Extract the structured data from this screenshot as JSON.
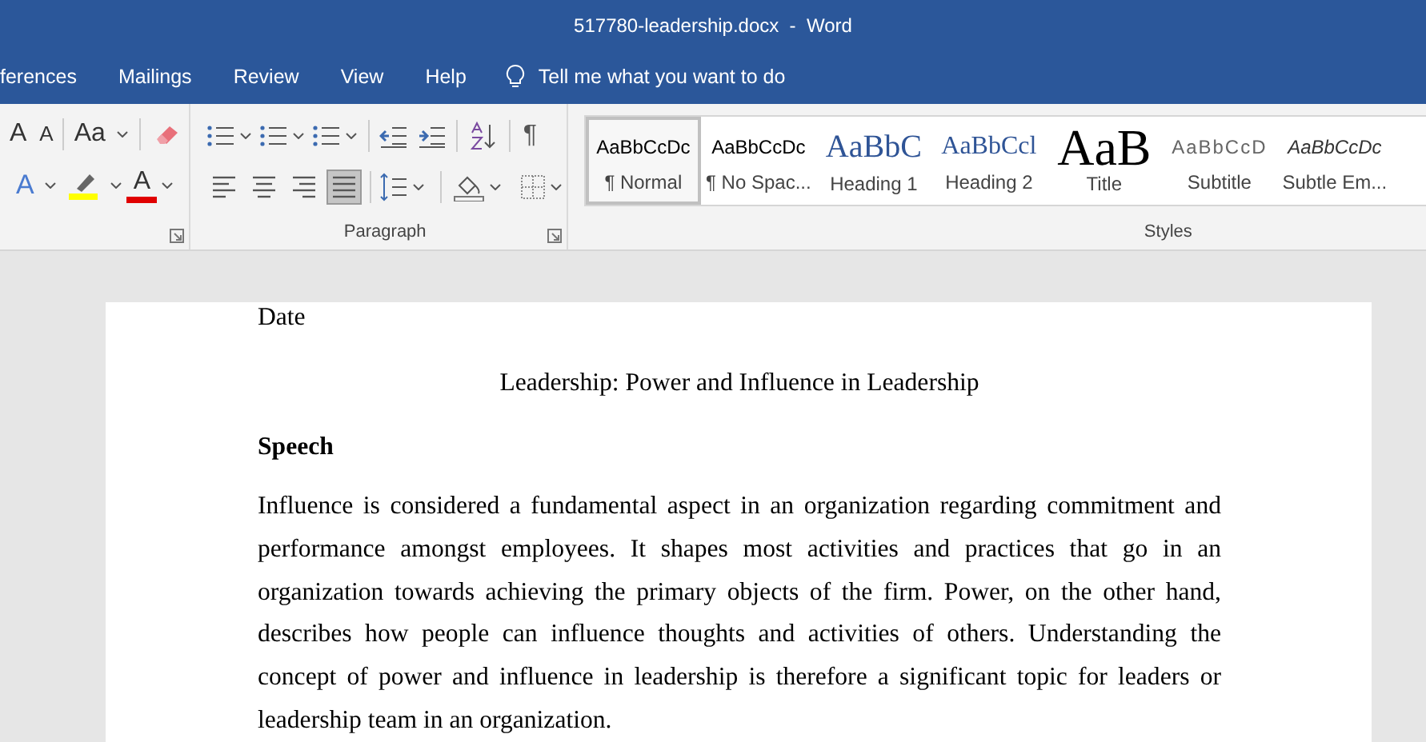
{
  "window": {
    "title": "517780-leadership.docx  -  Word"
  },
  "tabs": [
    {
      "label": "ferences",
      "selected": false
    },
    {
      "label": "Mailings",
      "selected": false
    },
    {
      "label": "Review",
      "selected": false
    },
    {
      "label": "View",
      "selected": false
    },
    {
      "label": "Help",
      "selected": false
    }
  ],
  "tell_me": {
    "placeholder": "Tell me what you want to do"
  },
  "font_group": {
    "row_1": [
      {
        "kind": "grow",
        "text": "A"
      },
      {
        "kind": "shrink",
        "text": "A"
      },
      {
        "kind": "case",
        "text": "Aa"
      },
      {
        "kind": "clear"
      }
    ],
    "row_2": [
      {
        "kind": "effects",
        "text": "A"
      },
      {
        "kind": "highlight"
      },
      {
        "kind": "color",
        "text": "A"
      }
    ]
  },
  "paragraph_group": {
    "label": "Paragraph",
    "show_marks": "¶",
    "alignments": [
      {
        "kind": "left",
        "selected": false
      },
      {
        "kind": "center",
        "selected": false
      },
      {
        "kind": "right",
        "selected": false
      },
      {
        "kind": "justify",
        "selected": true
      }
    ]
  },
  "styles_group": {
    "label": "Styles",
    "styles": [
      {
        "preview": "AaBbCcDc",
        "kind": "normal",
        "name": "¶ Normal",
        "selected": true
      },
      {
        "preview": "AaBbCcDc",
        "kind": "normal",
        "name": "¶ No Spac...",
        "selected": false
      },
      {
        "preview": "AaBbC",
        "kind": "heading1",
        "name": "Heading 1",
        "selected": false
      },
      {
        "preview": "AaBbCcl",
        "kind": "heading2",
        "name": "Heading 2",
        "selected": false
      },
      {
        "preview": "AaB",
        "kind": "title",
        "name": "Title",
        "selected": false
      },
      {
        "preview": "AaBbCcD",
        "kind": "subtitle",
        "name": "Subtitle",
        "selected": false
      },
      {
        "preview": "AaBbCcDc",
        "kind": "emphasis",
        "name": "Subtle Em...",
        "selected": false
      }
    ]
  },
  "document": {
    "date": "Date",
    "title": "Leadership: Power and Influence in Leadership",
    "heading": "Speech",
    "paragraph": "Influence is considered a fundamental aspect in an organization regarding commitment and performance amongst employees. It shapes most activities and practices that go in an organization towards achieving the primary objects of the firm. Power, on the other hand, describes how people can influence thoughts and activities of others. Understanding the concept of power and influence in leadership is therefore a significant topic for leaders or leadership team in an organization."
  }
}
